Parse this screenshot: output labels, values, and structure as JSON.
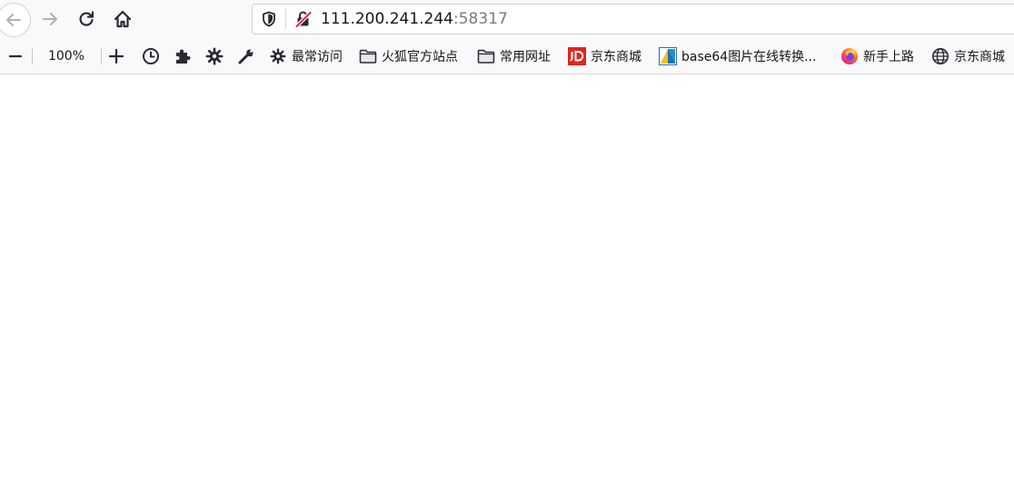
{
  "address_bar": {
    "host": "111.200.241.244",
    "port": ":58317"
  },
  "toolbar": {
    "zoom_level": "100%"
  },
  "bookmarks": [
    {
      "label": "最常访问",
      "icon": "gear-icon"
    },
    {
      "label": "火狐官方站点",
      "icon": "folder-icon"
    },
    {
      "label": "常用网址",
      "icon": "folder-icon"
    },
    {
      "label": "京东商城",
      "icon": "jd-logo-icon"
    },
    {
      "label": "base64图片在线转换...",
      "icon": "image-converter-icon"
    },
    {
      "label": "新手上路",
      "icon": "firefox-icon"
    },
    {
      "label": "京东商城",
      "icon": "globe-icon"
    }
  ],
  "colors": {
    "toolbar_bg": "#f9f9fb",
    "jd_red": "#e1251b",
    "insecure_red": "#e22850"
  }
}
